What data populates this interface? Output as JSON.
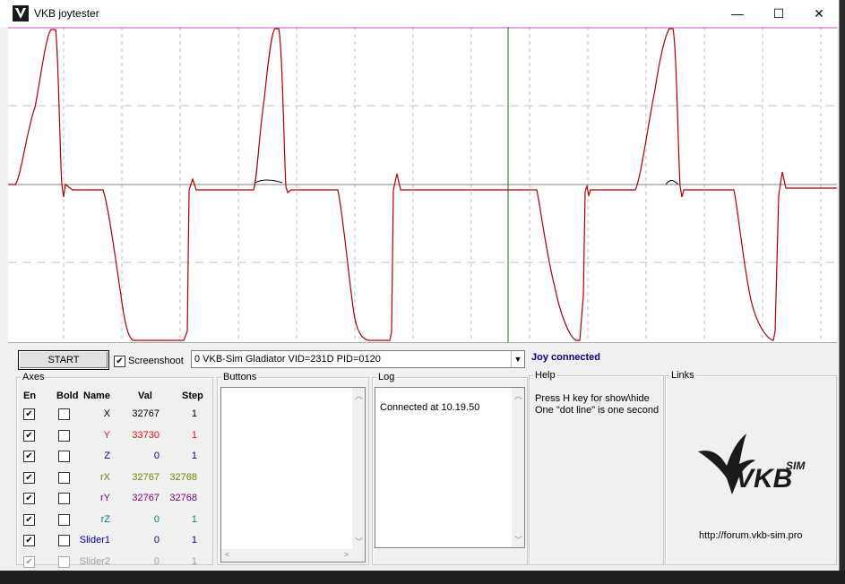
{
  "window": {
    "title": "VKB joytester",
    "minimize": "—",
    "maximize": "☐",
    "close": "✕"
  },
  "toolbar": {
    "start_label": "START",
    "screenshot_label": "Screenshoot",
    "screenshot_checked": true,
    "device_selected": "0  VKB-Sim Gladiator  VID=231D PID=0120",
    "status": "Joy connected"
  },
  "axes": {
    "title": "Axes",
    "headers": {
      "en": "En",
      "bold": "Bold",
      "name": "Name",
      "val": "Val",
      "step": "Step"
    },
    "rows": [
      {
        "enabled": true,
        "bold": false,
        "name": "X",
        "val": "32767",
        "step": "1",
        "color": "#000000"
      },
      {
        "enabled": true,
        "bold": false,
        "name": "Y",
        "val": "33730",
        "step": "1",
        "color": "#e81010"
      },
      {
        "enabled": true,
        "bold": false,
        "name": "Z",
        "val": "0",
        "step": "1",
        "color": "#000080"
      },
      {
        "enabled": true,
        "bold": false,
        "name": "rX",
        "val": "32767",
        "step": "32768",
        "color": "#7f7f00"
      },
      {
        "enabled": true,
        "bold": false,
        "name": "rY",
        "val": "32767",
        "step": "32768",
        "color": "#800080"
      },
      {
        "enabled": true,
        "bold": false,
        "name": "rZ",
        "val": "0",
        "step": "1",
        "color": "#008080"
      },
      {
        "enabled": true,
        "bold": false,
        "name": "Slider1",
        "val": "0",
        "step": "1",
        "color": "#0000a0"
      },
      {
        "enabled": false,
        "bold": false,
        "name": "Slider2",
        "val": "0",
        "step": "1",
        "color": "#a0a0a0"
      }
    ]
  },
  "buttons_group": {
    "title": "Buttons"
  },
  "log": {
    "title": "Log",
    "lines": [
      "Connected at 10.19.50"
    ]
  },
  "help": {
    "title": "Help",
    "line1": "Press H key for show\\hide",
    "line2": "One \"dot line\" is one second"
  },
  "links": {
    "title": "Links",
    "url": "http://forum.vkb-sim.pro",
    "logo_text": "VKB",
    "logo_sim": "SIM"
  },
  "colors": {
    "trace": "#b00000",
    "top_line": "#d050d0",
    "center_line": "#808080",
    "marker": "#008000",
    "grid": "#bfbfbf"
  },
  "icons": {
    "app": "vkb-app-icon",
    "checkbox": "checkmark-icon",
    "dropdown": "chevron-down-icon"
  }
}
